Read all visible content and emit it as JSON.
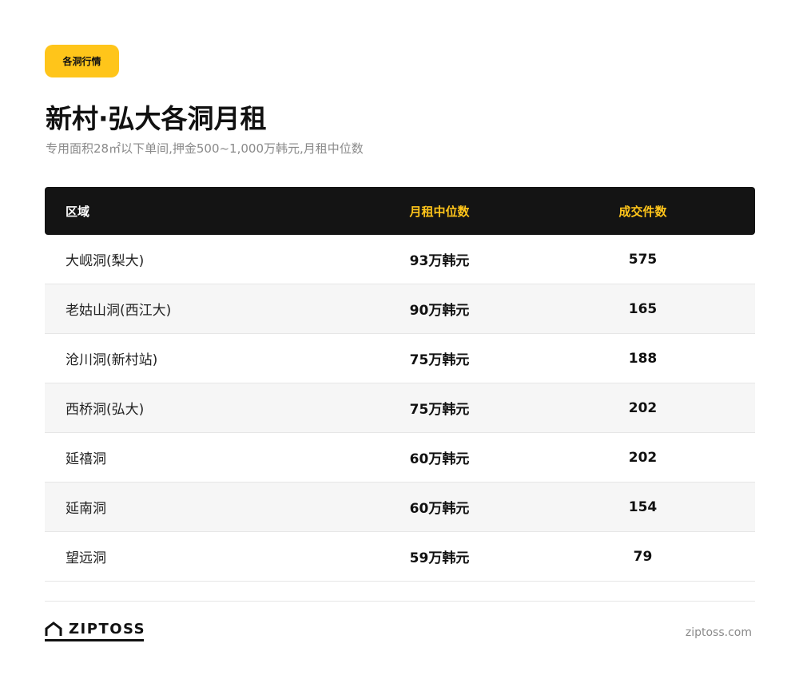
{
  "badge": {
    "label": "各洞行情"
  },
  "header": {
    "title": "新村·弘大各洞月租",
    "subtitle": "专用面积28㎡以下单间,押金500~1,000万韩元,月租中位数"
  },
  "table": {
    "columns": [
      "区域",
      "月租中位数",
      "成交件数"
    ],
    "rows": [
      {
        "area": "大岘洞(梨大)",
        "rent": "93万韩元",
        "count": "575"
      },
      {
        "area": "老姑山洞(西江大)",
        "rent": "90万韩元",
        "count": "165"
      },
      {
        "area": "沧川洞(新村站)",
        "rent": "75万韩元",
        "count": "188"
      },
      {
        "area": "西桥洞(弘大)",
        "rent": "75万韩元",
        "count": "202"
      },
      {
        "area": "延禧洞",
        "rent": "60万韩元",
        "count": "202"
      },
      {
        "area": "延南洞",
        "rent": "60万韩元",
        "count": "154"
      },
      {
        "area": "望远洞",
        "rent": "59万韩元",
        "count": "79"
      }
    ]
  },
  "footer": {
    "logo_text": "ZIPTOSS",
    "logo_icon": "house-icon",
    "site": "ziptoss.com"
  },
  "colors": {
    "accent": "#FFC51A",
    "header_bg": "#141414",
    "alt_row": "#F6F6F6",
    "muted_text": "#8A8A8A"
  }
}
